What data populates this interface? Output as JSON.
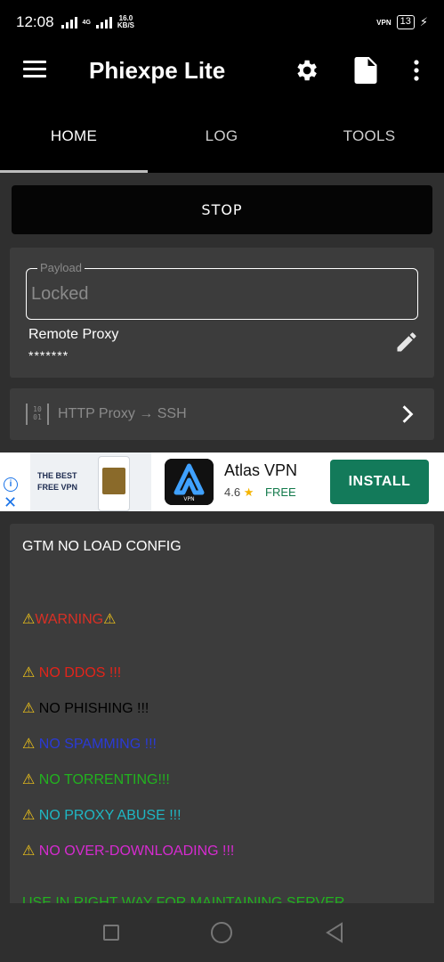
{
  "status": {
    "time": "12:08",
    "net_type": "4G",
    "speed_value": "16.0",
    "speed_unit": "KB/S",
    "vpn": "VPN",
    "battery": "13"
  },
  "appbar": {
    "title": "Phiexpe Lite"
  },
  "tabs": [
    {
      "label": "HOME"
    },
    {
      "label": "LOG"
    },
    {
      "label": "TOOLS"
    }
  ],
  "home": {
    "stop_label": "STOP",
    "payload_label": "Payload",
    "payload_value": "Locked",
    "remote_proxy_label": "Remote Proxy",
    "remote_proxy_value": "*******",
    "tunnel_label": "HTTP Proxy → SSH",
    "binary_glyph_top": "10",
    "binary_glyph_bottom": "01"
  },
  "ad": {
    "banner_line1": "THE BEST",
    "banner_line2": "FREE VPN",
    "title": "Atlas VPN",
    "rating": "4.6",
    "price": "FREE",
    "install_label": "INSTALL",
    "info_glyph": "i",
    "close_glyph": "✕"
  },
  "config": {
    "title": "GTM NO LOAD CONFIG",
    "lines": [
      {
        "text": "WARNING",
        "color": "#d93025"
      },
      {
        "text": "NO DDOS !!!",
        "color": "#e3241a"
      },
      {
        "text": "NO PHISHING !!!",
        "color": "#000000"
      },
      {
        "text": "NO SPAMMING !!!",
        "color": "#2a3ad6"
      },
      {
        "text": "NO TORRENTING!!!",
        "color": "#22b21f"
      },
      {
        "text": "NO PROXY ABUSE !!!",
        "color": "#1fb7c4"
      },
      {
        "text": "NO OVER-DOWNLOADING !!!",
        "color": "#d62bd0"
      },
      {
        "text": "USE IN RIGHT WAY FOR MAINTAINING SERVER",
        "color": "#22b21f"
      }
    ],
    "warning_glyph": "⚠"
  }
}
